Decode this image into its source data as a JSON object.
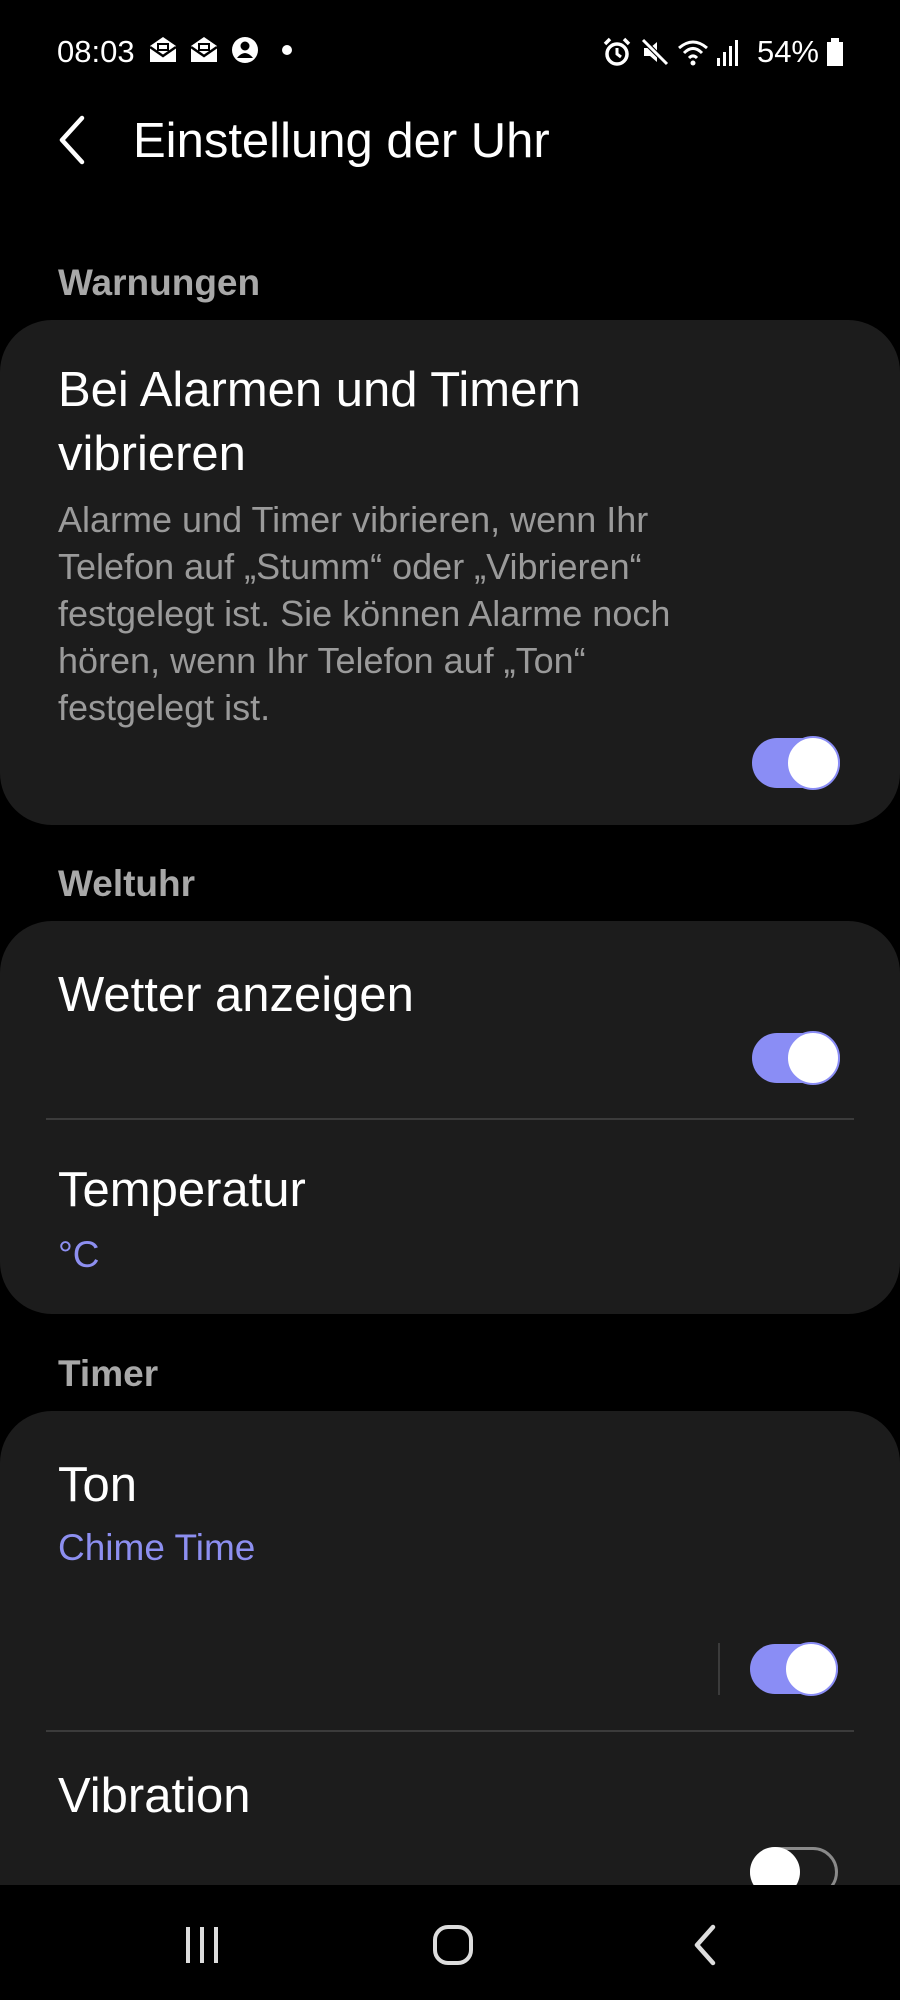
{
  "status_bar": {
    "time": "08:03",
    "left_icons": [
      "mail-icon",
      "mail-icon",
      "account-icon",
      "dot-icon"
    ],
    "right_icons": [
      "alarm-icon",
      "mute-icon",
      "wifi-icon",
      "signal-icon"
    ],
    "battery_percent": "54%"
  },
  "header": {
    "title": "Einstellung der Uhr"
  },
  "sections": {
    "warnings": {
      "label": "Warnungen",
      "vibrate_title": "Bei Alarmen und Timern vibrieren",
      "vibrate_desc": "Alarme und Timer vibrieren, wenn Ihr Telefon auf „Stumm“ oder „Vibrieren“ festgelegt ist. Sie können Alarme noch hören, wenn Ihr Telefon auf „Ton“ festgelegt ist.",
      "vibrate_enabled": true
    },
    "world_clock": {
      "label": "Weltuhr",
      "weather_title": "Wetter anzeigen",
      "weather_enabled": true,
      "temperature_title": "Temperatur",
      "temperature_value": "°C"
    },
    "timer": {
      "label": "Timer",
      "sound_title": "Ton",
      "sound_value": "Chime Time",
      "sound_enabled": true,
      "vibration_title": "Vibration",
      "vibration_enabled": false
    }
  },
  "colors": {
    "accent": "#8a8df5",
    "card": "#1c1c1c",
    "background": "#000000",
    "secondary_text": "#9a9a9a"
  },
  "nav_bar": {
    "icons": [
      "recents-icon",
      "home-icon",
      "back-icon"
    ]
  }
}
